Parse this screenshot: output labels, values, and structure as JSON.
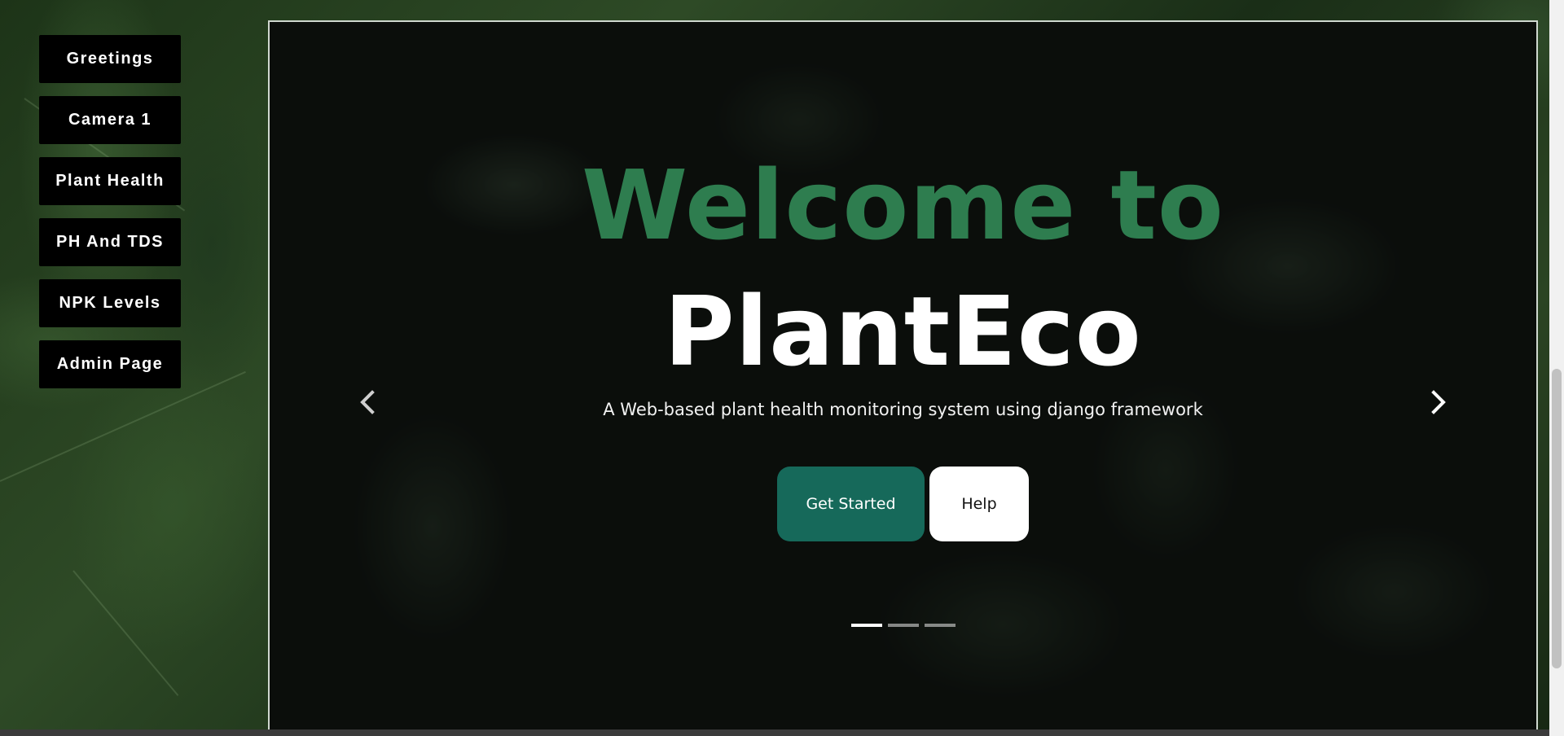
{
  "sidebar": {
    "items": [
      {
        "label": "Greetings"
      },
      {
        "label": "Camera 1"
      },
      {
        "label": "Plant Health"
      },
      {
        "label": "PH And TDS"
      },
      {
        "label": "NPK Levels"
      },
      {
        "label": "Admin Page"
      }
    ]
  },
  "hero": {
    "title_line1": "Welcome to",
    "title_line2": "PlantEco",
    "subtitle": "A Web-based plant health monitoring system using django framework",
    "primary_button": "Get Started",
    "secondary_button": "Help",
    "prev_icon": "chevron-left-icon",
    "next_icon": "chevron-right-icon",
    "slides_total": 3,
    "active_slide": 1
  },
  "colors": {
    "welcome_green": "#2e7d4f",
    "primary_button": "#16695a",
    "sidebar_button": "#000000"
  }
}
